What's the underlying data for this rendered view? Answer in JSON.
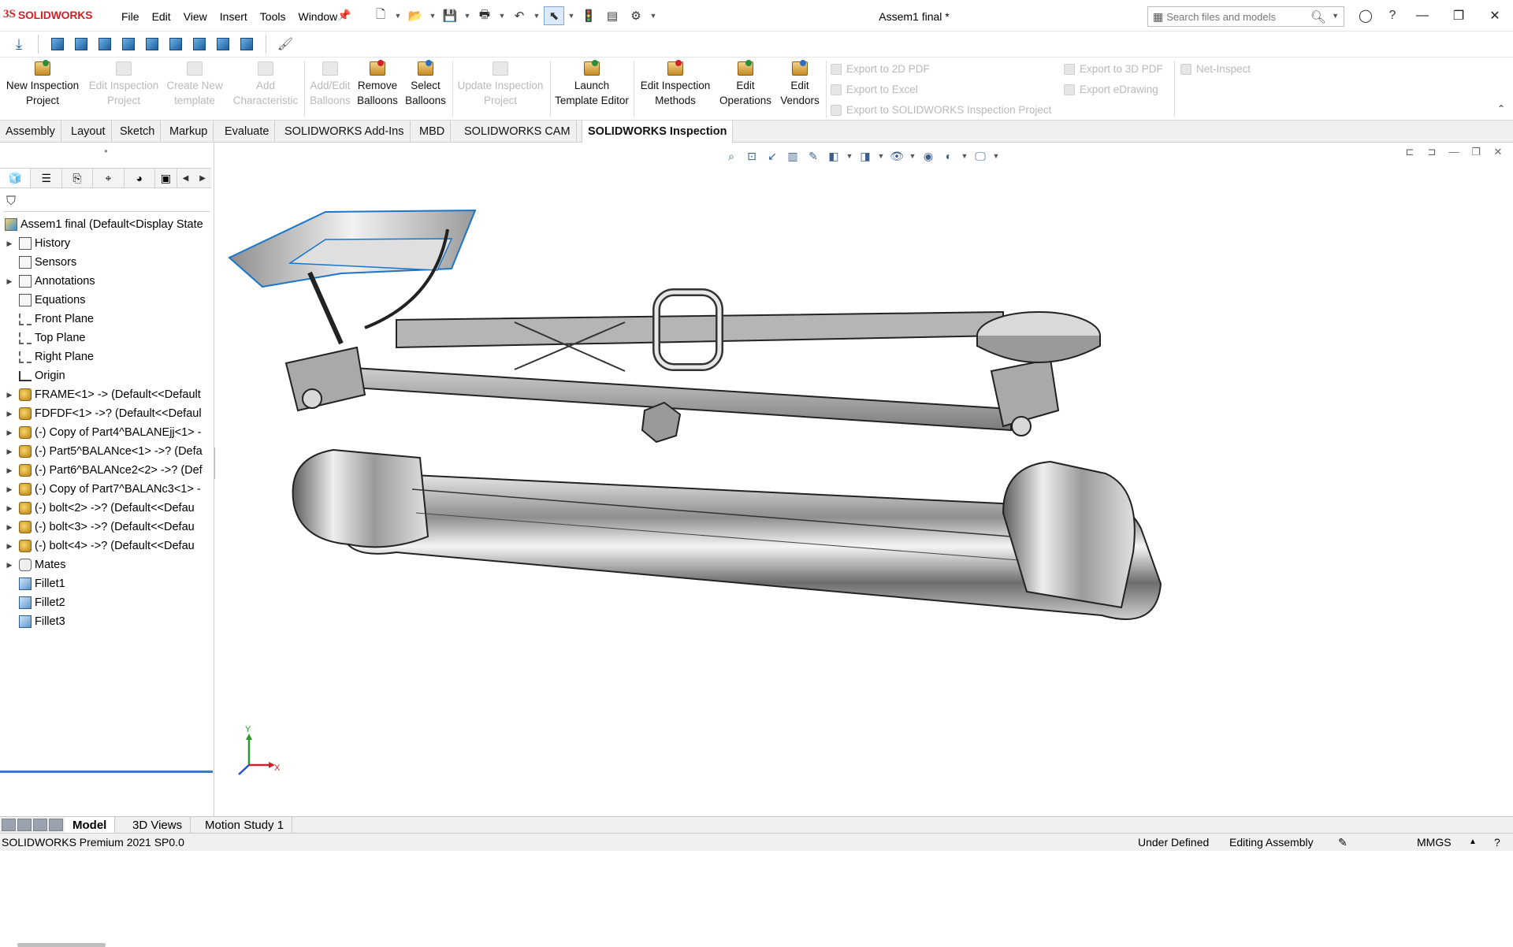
{
  "app": {
    "logo_text": "SOLIDWORKS",
    "document_title": "Assem1 final *"
  },
  "menu": [
    "File",
    "Edit",
    "View",
    "Insert",
    "Tools",
    "Window"
  ],
  "search": {
    "placeholder": "Search files and models"
  },
  "ribbon": {
    "new_inspection_project": "New Inspection Project",
    "edit_inspection_project": "Edit Inspection Project",
    "create_new_template": "Create New template",
    "add_characteristic": "Add Characteristic",
    "add_edit_balloons": "Add/Edit Balloons",
    "remove_balloons": "Remove Balloons",
    "select_balloons": "Select Balloons",
    "update_inspection_project": "Update Inspection Project",
    "launch_template_editor": "Launch Template Editor",
    "edit_inspection_methods": "Edit Inspection Methods",
    "edit_operations": "Edit Operations",
    "edit_vendors": "Edit Vendors",
    "export_2d_pdf": "Export to 2D PDF",
    "export_excel": "Export to Excel",
    "export_sw_inspection": "Export to SOLIDWORKS Inspection Project",
    "export_3d_pdf": "Export to 3D PDF",
    "export_edrawing": "Export eDrawing",
    "net_inspect": "Net-Inspect"
  },
  "tabs": [
    "Assembly",
    "Layout",
    "Sketch",
    "Markup",
    "Evaluate",
    "SOLIDWORKS Add-Ins",
    "MBD",
    "SOLIDWORKS CAM",
    "SOLIDWORKS Inspection"
  ],
  "tree": [
    "Assem1 final  (Default<Display State",
    "History",
    "Sensors",
    "Annotations",
    "Equations",
    "Front Plane",
    "Top Plane",
    "Right Plane",
    "Origin",
    "FRAME<1> -> (Default<<Default",
    "FDFDF<1> ->? (Default<<Defaul",
    "(-) Copy of Part4^BALANEjj<1> -",
    "(-) Part5^BALANce<1> ->? (Defa",
    "(-) Part6^BALANce2<2> ->? (Def",
    "(-) Copy of Part7^BALANc3<1> -",
    "(-) bolt<2> ->? (Default<<Defau",
    "(-) bolt<3> ->? (Default<<Defau",
    "(-) bolt<4> ->? (Default<<Defau",
    "Mates",
    "Fillet1",
    "Fillet2",
    "Fillet3"
  ],
  "triad": {
    "x": "X",
    "y": "Y"
  },
  "bottom_tabs": [
    "Model",
    "3D Views",
    "Motion Study 1"
  ],
  "status": {
    "product": "SOLIDWORKS Premium 2021 SP0.0",
    "definition": "Under Defined",
    "mode": "Editing Assembly",
    "units": "MMGS"
  }
}
